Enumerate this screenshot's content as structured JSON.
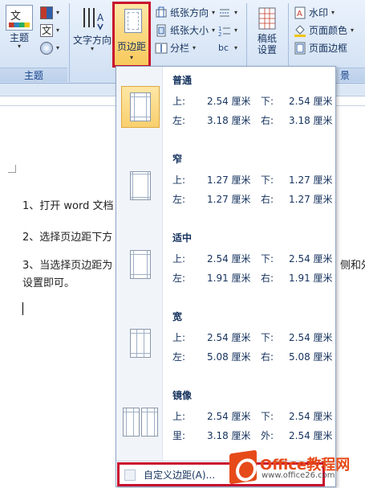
{
  "ribbon": {
    "theme": {
      "label": "主题",
      "icon_text": "文",
      "group_label": "主题"
    },
    "theme_small": [
      {
        "name": "theme-colors-icon"
      },
      {
        "name": "theme-fonts-icon",
        "text": "文"
      },
      {
        "name": "theme-effects-icon"
      }
    ],
    "text_direction": {
      "label": "文字方向"
    },
    "margins": {
      "label": "页边距"
    },
    "page_setup_small": [
      {
        "label": "纸张方向"
      },
      {
        "label": "纸张大小"
      },
      {
        "label": "分栏"
      }
    ],
    "page_setup_tiny": [
      {
        "name": "breaks-icon"
      },
      {
        "name": "line-numbers-icon"
      },
      {
        "name": "hyphenation-icon",
        "text": "bc"
      }
    ],
    "draft_paper": {
      "label1": "稿纸",
      "label2": "设置"
    },
    "background_small": [
      {
        "label": "水印"
      },
      {
        "label": "页面颜色"
      },
      {
        "label": "页面边框"
      }
    ],
    "bg_group_label_fragment": "景"
  },
  "document": {
    "paragraphs": [
      "1、打开 word 文档",
      "2、选择页边距下方",
      "3、当选择页边距为",
      "设置即可。"
    ],
    "para3_tail": "侧和外"
  },
  "margins_menu": {
    "options": [
      {
        "name": "普通",
        "rows": [
          [
            "上:",
            "2.54 厘米",
            "下:",
            "2.54 厘米"
          ],
          [
            "左:",
            "3.18 厘米",
            "右:",
            "3.18 厘米"
          ]
        ],
        "selected": true
      },
      {
        "name": "窄",
        "rows": [
          [
            "上:",
            "1.27 厘米",
            "下:",
            "1.27 厘米"
          ],
          [
            "左:",
            "1.27 厘米",
            "右:",
            "1.27 厘米"
          ]
        ],
        "selected": false
      },
      {
        "name": "适中",
        "rows": [
          [
            "上:",
            "2.54 厘米",
            "下:",
            "2.54 厘米"
          ],
          [
            "左:",
            "1.91 厘米",
            "右:",
            "1.91 厘米"
          ]
        ],
        "selected": false
      },
      {
        "name": "宽",
        "rows": [
          [
            "上:",
            "2.54 厘米",
            "下:",
            "2.54 厘米"
          ],
          [
            "左:",
            "5.08 厘米",
            "右:",
            "5.08 厘米"
          ]
        ],
        "selected": false
      },
      {
        "name": "镜像",
        "rows": [
          [
            "上:",
            "2.54 厘米",
            "下:",
            "2.54 厘米"
          ],
          [
            "里:",
            "3.18 厘米",
            "外:",
            "2.54 厘米"
          ]
        ],
        "selected": false
      }
    ],
    "custom_label": "自定义边距(A)..."
  },
  "watermark": {
    "word": "Office教程网",
    "url": "www.office26.com"
  },
  "colors": {
    "highlight_border": "#c8102e",
    "selected_bg": "#f9cf6e",
    "ribbon_text": "#15325e"
  }
}
